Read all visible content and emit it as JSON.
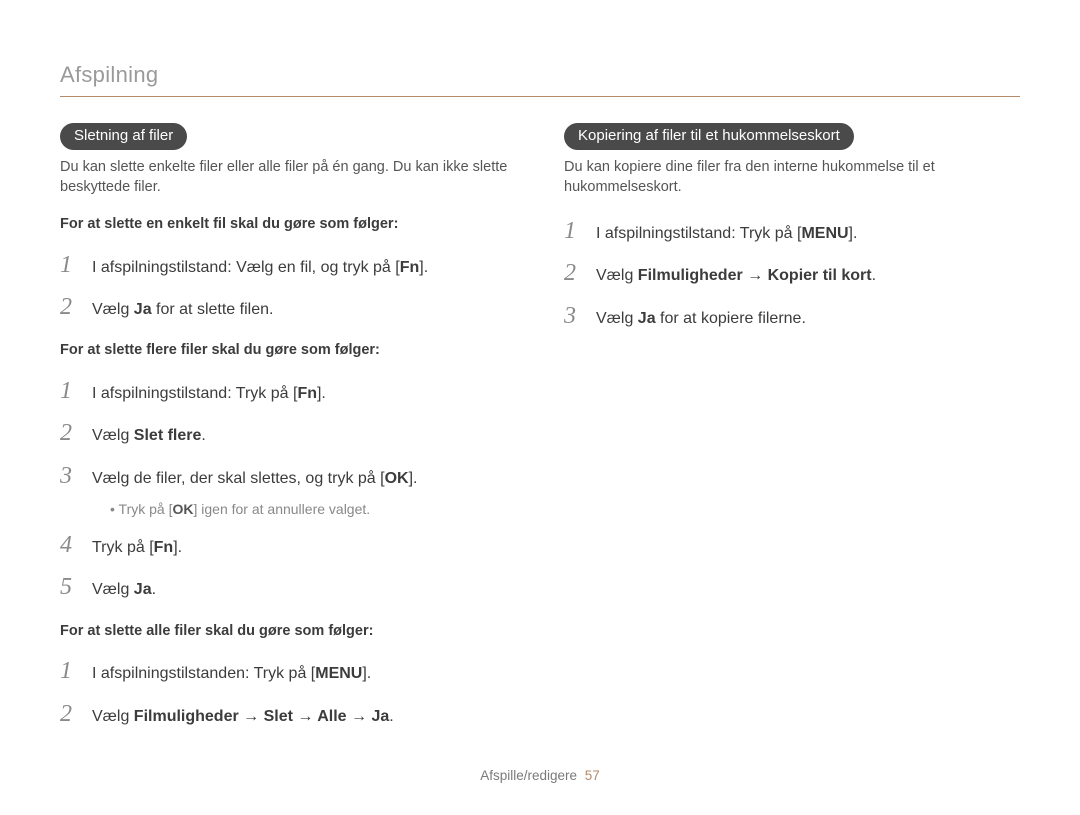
{
  "header": {
    "section": "Afspilning"
  },
  "footer": {
    "label": "Afspille/redigere",
    "page": "57"
  },
  "left": {
    "pill": "Sletning af filer",
    "intro": "Du kan slette enkelte filer eller alle filer på én gang. Du kan ikke slette beskyttede filer.",
    "sub1": "For at slette en enkelt fil skal du gøre som følger:",
    "steps1": [
      {
        "n": "1",
        "pre": "I afspilningstilstand: Vælg en fil, og tryk på [",
        "key": "Fn",
        "post": "]."
      },
      {
        "n": "2",
        "pre": "Vælg ",
        "bold": "Ja",
        "post": " for at slette filen."
      }
    ],
    "sub2": "For at slette flere filer skal du gøre som følger:",
    "steps2": [
      {
        "n": "1",
        "pre": "I afspilningstilstand: Tryk på [",
        "key": "Fn",
        "post": "]."
      },
      {
        "n": "2",
        "pre": "Vælg ",
        "bold": "Slet flere",
        "post": "."
      },
      {
        "n": "3",
        "pre": "Vælg de filer, der skal slettes, og tryk på [",
        "key": "OK",
        "post": "]."
      },
      {
        "n": "4",
        "pre": "Tryk på [",
        "key": "Fn",
        "post": "]."
      },
      {
        "n": "5",
        "pre": "Vælg ",
        "bold": "Ja",
        "post": "."
      }
    ],
    "sub2_note": {
      "pre": "•  Tryk på [",
      "key": "OK",
      "post": "] igen for at annullere valget."
    },
    "sub3": "For at slette alle filer skal du gøre som følger:",
    "steps3": [
      {
        "n": "1",
        "pre": "I afspilningstilstanden: Tryk på [",
        "key": "MENU",
        "post": "]."
      },
      {
        "n": "2",
        "pre": "Vælg ",
        "bold": "Filmuligheder → Slet → Alle → Ja",
        "post": "."
      }
    ]
  },
  "right": {
    "pill": "Kopiering af filer til et hukommelseskort",
    "intro": "Du kan kopiere dine filer fra den interne hukommelse til et hukommelseskort.",
    "steps": [
      {
        "n": "1",
        "pre": "I afspilningstilstand: Tryk på [",
        "key": "MENU",
        "post": "]."
      },
      {
        "n": "2",
        "pre": "Vælg ",
        "bold": "Filmuligheder → Kopier til kort",
        "post": "."
      },
      {
        "n": "3",
        "pre": "Vælg ",
        "bold": "Ja",
        "post": " for at kopiere filerne."
      }
    ]
  }
}
